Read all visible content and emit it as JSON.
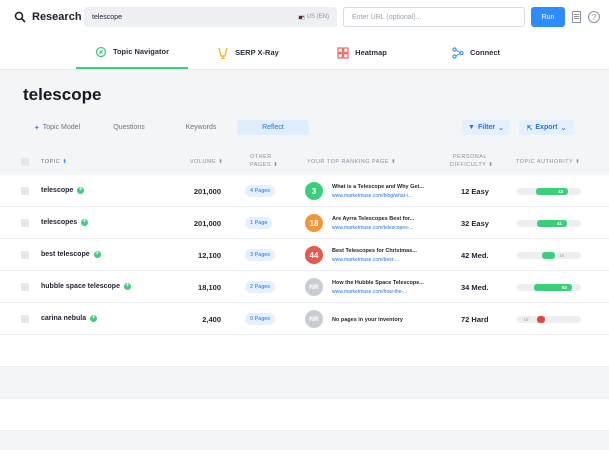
{
  "header": {
    "brand": "Research",
    "search_value": "telescope",
    "search_lang": "US (EN)",
    "url_placeholder": "Enter URL (optional)...",
    "run_label": "Run"
  },
  "tabs": [
    {
      "label": "Topic Navigator",
      "icon": "compass-icon",
      "active": true
    },
    {
      "label": "SERP X-Ray",
      "icon": "xray-icon"
    },
    {
      "label": "Heatmap",
      "icon": "heatmap-icon"
    },
    {
      "label": "Connect",
      "icon": "connect-icon"
    }
  ],
  "page_title": "telescope",
  "subtabs": [
    "Topic Model",
    "Questions",
    "Keywords",
    "Reflect"
  ],
  "actions": {
    "filter": "Filter",
    "export": "Export"
  },
  "table": {
    "headers": {
      "topic": "TOPIC",
      "volume": "VOLUME",
      "other_pages_1": "OTHER",
      "other_pages_2": "PAGES",
      "ranking": "YOUR TOP RANKING PAGE",
      "difficulty_1": "PERSONAL",
      "difficulty_2": "DIFFICULTY",
      "authority": "TOPIC AUTHORITY"
    },
    "rows": [
      {
        "topic": "telescope",
        "volume": "201,000",
        "pages": "4 Pages",
        "rank": "3",
        "rank_color": "#3bcf7a",
        "page_title": "What is a Telescope and Why Get...",
        "page_url": "www.marketmuse.com/blog/what-i...",
        "difficulty": "12 Easy",
        "authority": 43,
        "authority_color": "#3bcf7a"
      },
      {
        "topic": "telescopes",
        "volume": "201,000",
        "pages": "1 Page",
        "rank": "18",
        "rank_color": "#f5953a",
        "page_title": "Are Ayrra Telescopes Best for...",
        "page_url": "www.marketmuse.com/telescopes-...",
        "difficulty": "32 Easy",
        "authority": 41,
        "authority_color": "#3bcf7a"
      },
      {
        "topic": "best telescope",
        "volume": "12,100",
        "pages": "3 Pages",
        "rank": "44",
        "rank_color": "#e8584d",
        "page_title": "Best Telescopes for Christmas...",
        "page_url": "www.marketmuse.com/best-...",
        "difficulty": "42 Med.",
        "authority": 18,
        "authority_color": "#3bcf7a"
      },
      {
        "topic": "hubble space telescope",
        "volume": "18,100",
        "pages": "2 Pages",
        "rank": "NR",
        "rank_color": "#c9ccd2",
        "page_title": "How the Hubble Space Telescope...",
        "page_url": "www.marketmuse.com/how-the-...",
        "difficulty": "34 Med.",
        "authority": 52,
        "authority_color": "#3bcf7a"
      },
      {
        "topic": "carina nebula",
        "volume": "2,400",
        "pages": "0 Pages",
        "rank": "NR",
        "rank_color": "#c9ccd2",
        "page_title": "",
        "page_url": "",
        "no_pages_text": "No pages in your inventory",
        "difficulty": "72 Hard",
        "authority": -18,
        "authority_color": "#e8453c"
      }
    ]
  }
}
